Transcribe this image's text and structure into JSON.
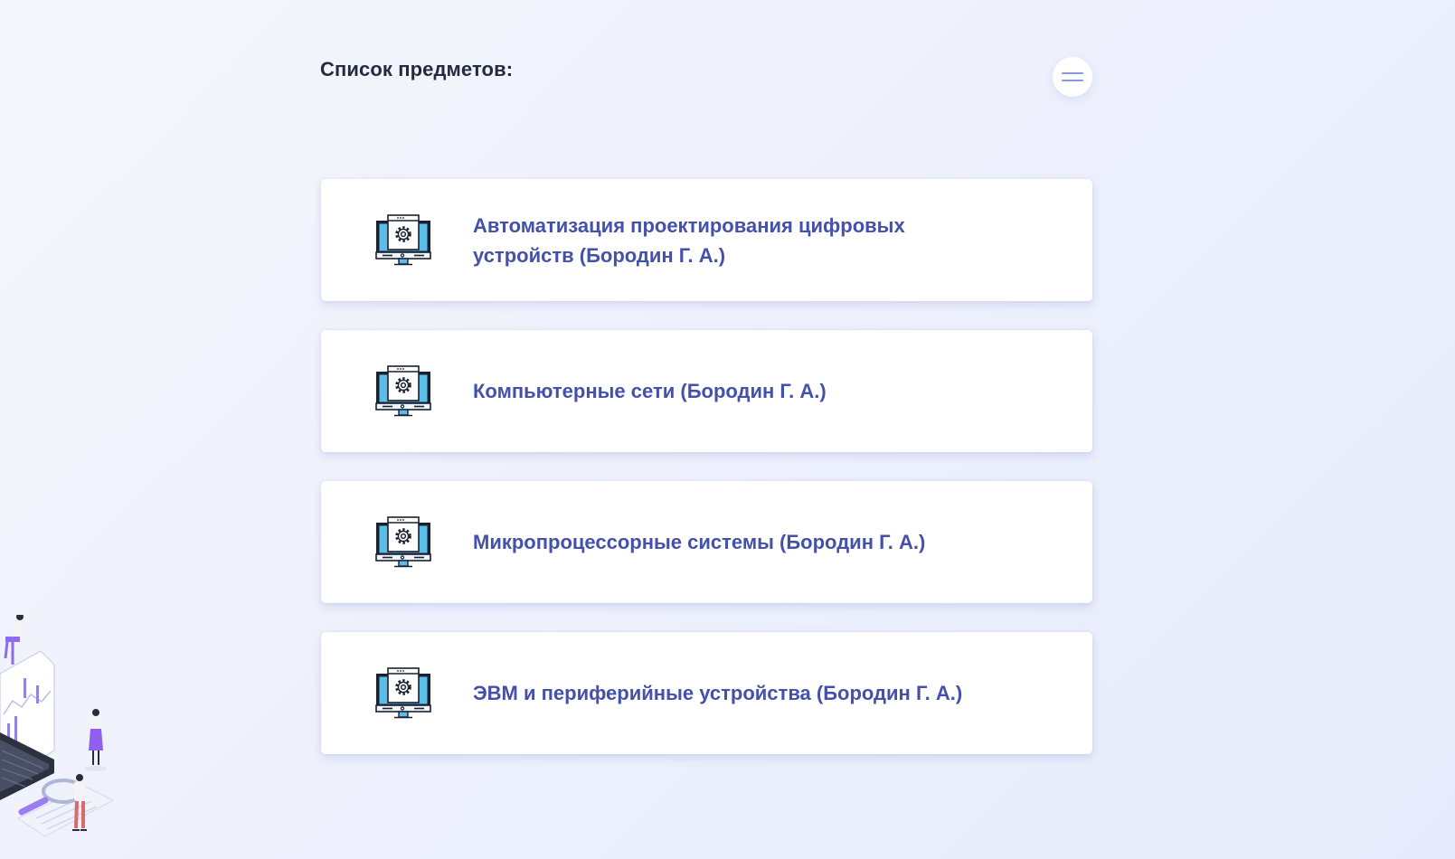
{
  "header": {
    "title": "Список предметов:"
  },
  "menu": {
    "icon": "hamburger-menu-icon"
  },
  "subjects": [
    {
      "label": "Автоматизация проектирования цифровых устройств (Бородин Г. А.)",
      "icon": "monitor-gear-icon"
    },
    {
      "label": "Компьютерные сети (Бородин Г. А.)",
      "icon": "monitor-gear-icon"
    },
    {
      "label": "Микропроцессорные системы (Бородин Г. А.)",
      "icon": "monitor-gear-icon"
    },
    {
      "label": "ЭВМ и периферийные устройства (Бородин Г. А.)",
      "icon": "monitor-gear-icon"
    }
  ],
  "colors": {
    "title": "#252b3f",
    "link": "#4351ab",
    "accent": "#8a98dc",
    "monitor_screen": "#5bbde8"
  }
}
